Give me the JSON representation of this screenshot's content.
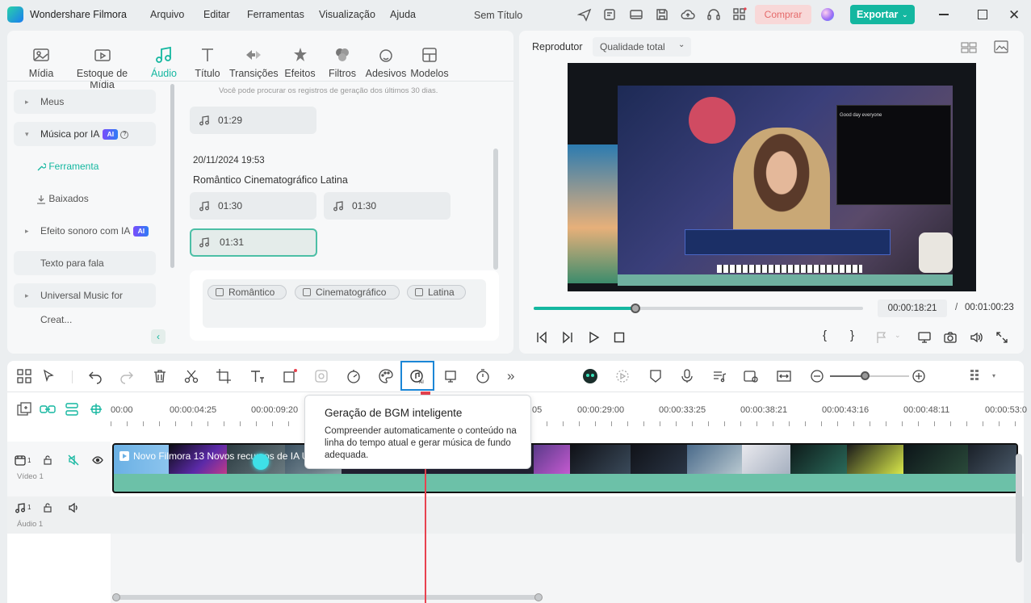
{
  "titlebar": {
    "app_name": "Wondershare Filmora",
    "menu": [
      "Arquivo",
      "Editar",
      "Ferramentas",
      "Visualização",
      "Ajuda"
    ],
    "project_title": "Sem Título",
    "buy_label": "Comprar",
    "export_label": "Exportar"
  },
  "media_tabs": [
    "Mídia",
    "Estoque de Mídia",
    "Áudio",
    "Título",
    "Transições",
    "Efeitos",
    "Filtros",
    "Adesivos",
    "Modelos"
  ],
  "active_tab": "Áudio",
  "sidebar": {
    "items": [
      {
        "label": "Meus"
      },
      {
        "label": "Música por IA",
        "badge": "AI"
      },
      {
        "label": "Ferramenta"
      },
      {
        "label": "Baixados"
      },
      {
        "label": "Efeito sonoro com IA",
        "badge": "AI"
      },
      {
        "label": "Texto para fala"
      },
      {
        "label": "Universal Music for Creat..."
      }
    ]
  },
  "history": {
    "hint": "Você pode procurar os registros de geração dos últimos 30 dias.",
    "top_chip": "01:29",
    "group_date": "20/11/2024 19:53",
    "group_title": "Romântico Cinematográfico Latina",
    "chips": [
      "01:30",
      "01:30",
      "01:31"
    ],
    "tags": [
      "Romântico",
      "Cinematográfico",
      "Latina"
    ]
  },
  "player": {
    "label": "Reprodutor",
    "quality": "Qualidade total",
    "current_time": "00:00:18:21",
    "separator": "/",
    "total_time": "00:01:00:23",
    "progress": 0.31,
    "overlay_text": "Good day everyone"
  },
  "tooltip": {
    "title": "Geração de BGM inteligente",
    "body": "Compreender automaticamente o conteúdo na linha do tempo atual e gerar música de fundo adequada."
  },
  "timeline": {
    "ruler": [
      "00:00",
      "00:00:04:25",
      "00:00:09:20",
      "05",
      "00:00:29:00",
      "00:00:33:25",
      "00:00:38:21",
      "00:00:43:16",
      "00:00:48:11",
      "00:00:53:0"
    ],
    "video_track_label": "Vídeo 1",
    "video_track_num": "1",
    "audio_track_label": "Áudio 1",
    "audio_track_num": "1",
    "clip_title": "Novo Filmora 13 Novos recursos de IA  U"
  },
  "colors": {
    "accent": "#14b7a0",
    "playhead": "#e8424f",
    "clip": "#6cc1a8"
  }
}
